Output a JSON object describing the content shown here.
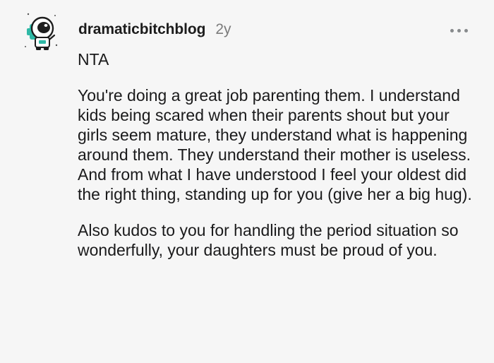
{
  "comment": {
    "author": "dramaticbitchblog",
    "age": "2y",
    "avatar_icon": "astronaut-avatar-icon",
    "menu_icon": "more-options-icon",
    "paragraphs": [
      "NTA",
      "You're doing a great job parenting them. I understand kids being scared when their parents shout but your girls seem mature, they understand what is happening around them. They understand their mother is useless. And from what I have understood I feel your oldest did the right thing, standing up for you (give her a big hug).",
      "Also kudos to you for handling the period situation so wonderfully, your daughters must be proud of you."
    ]
  },
  "colors": {
    "background": "#f6f6f6",
    "text": "#1a1a1b",
    "meta": "#7c7c7c",
    "avatar_accent": "#2fb9a6"
  }
}
